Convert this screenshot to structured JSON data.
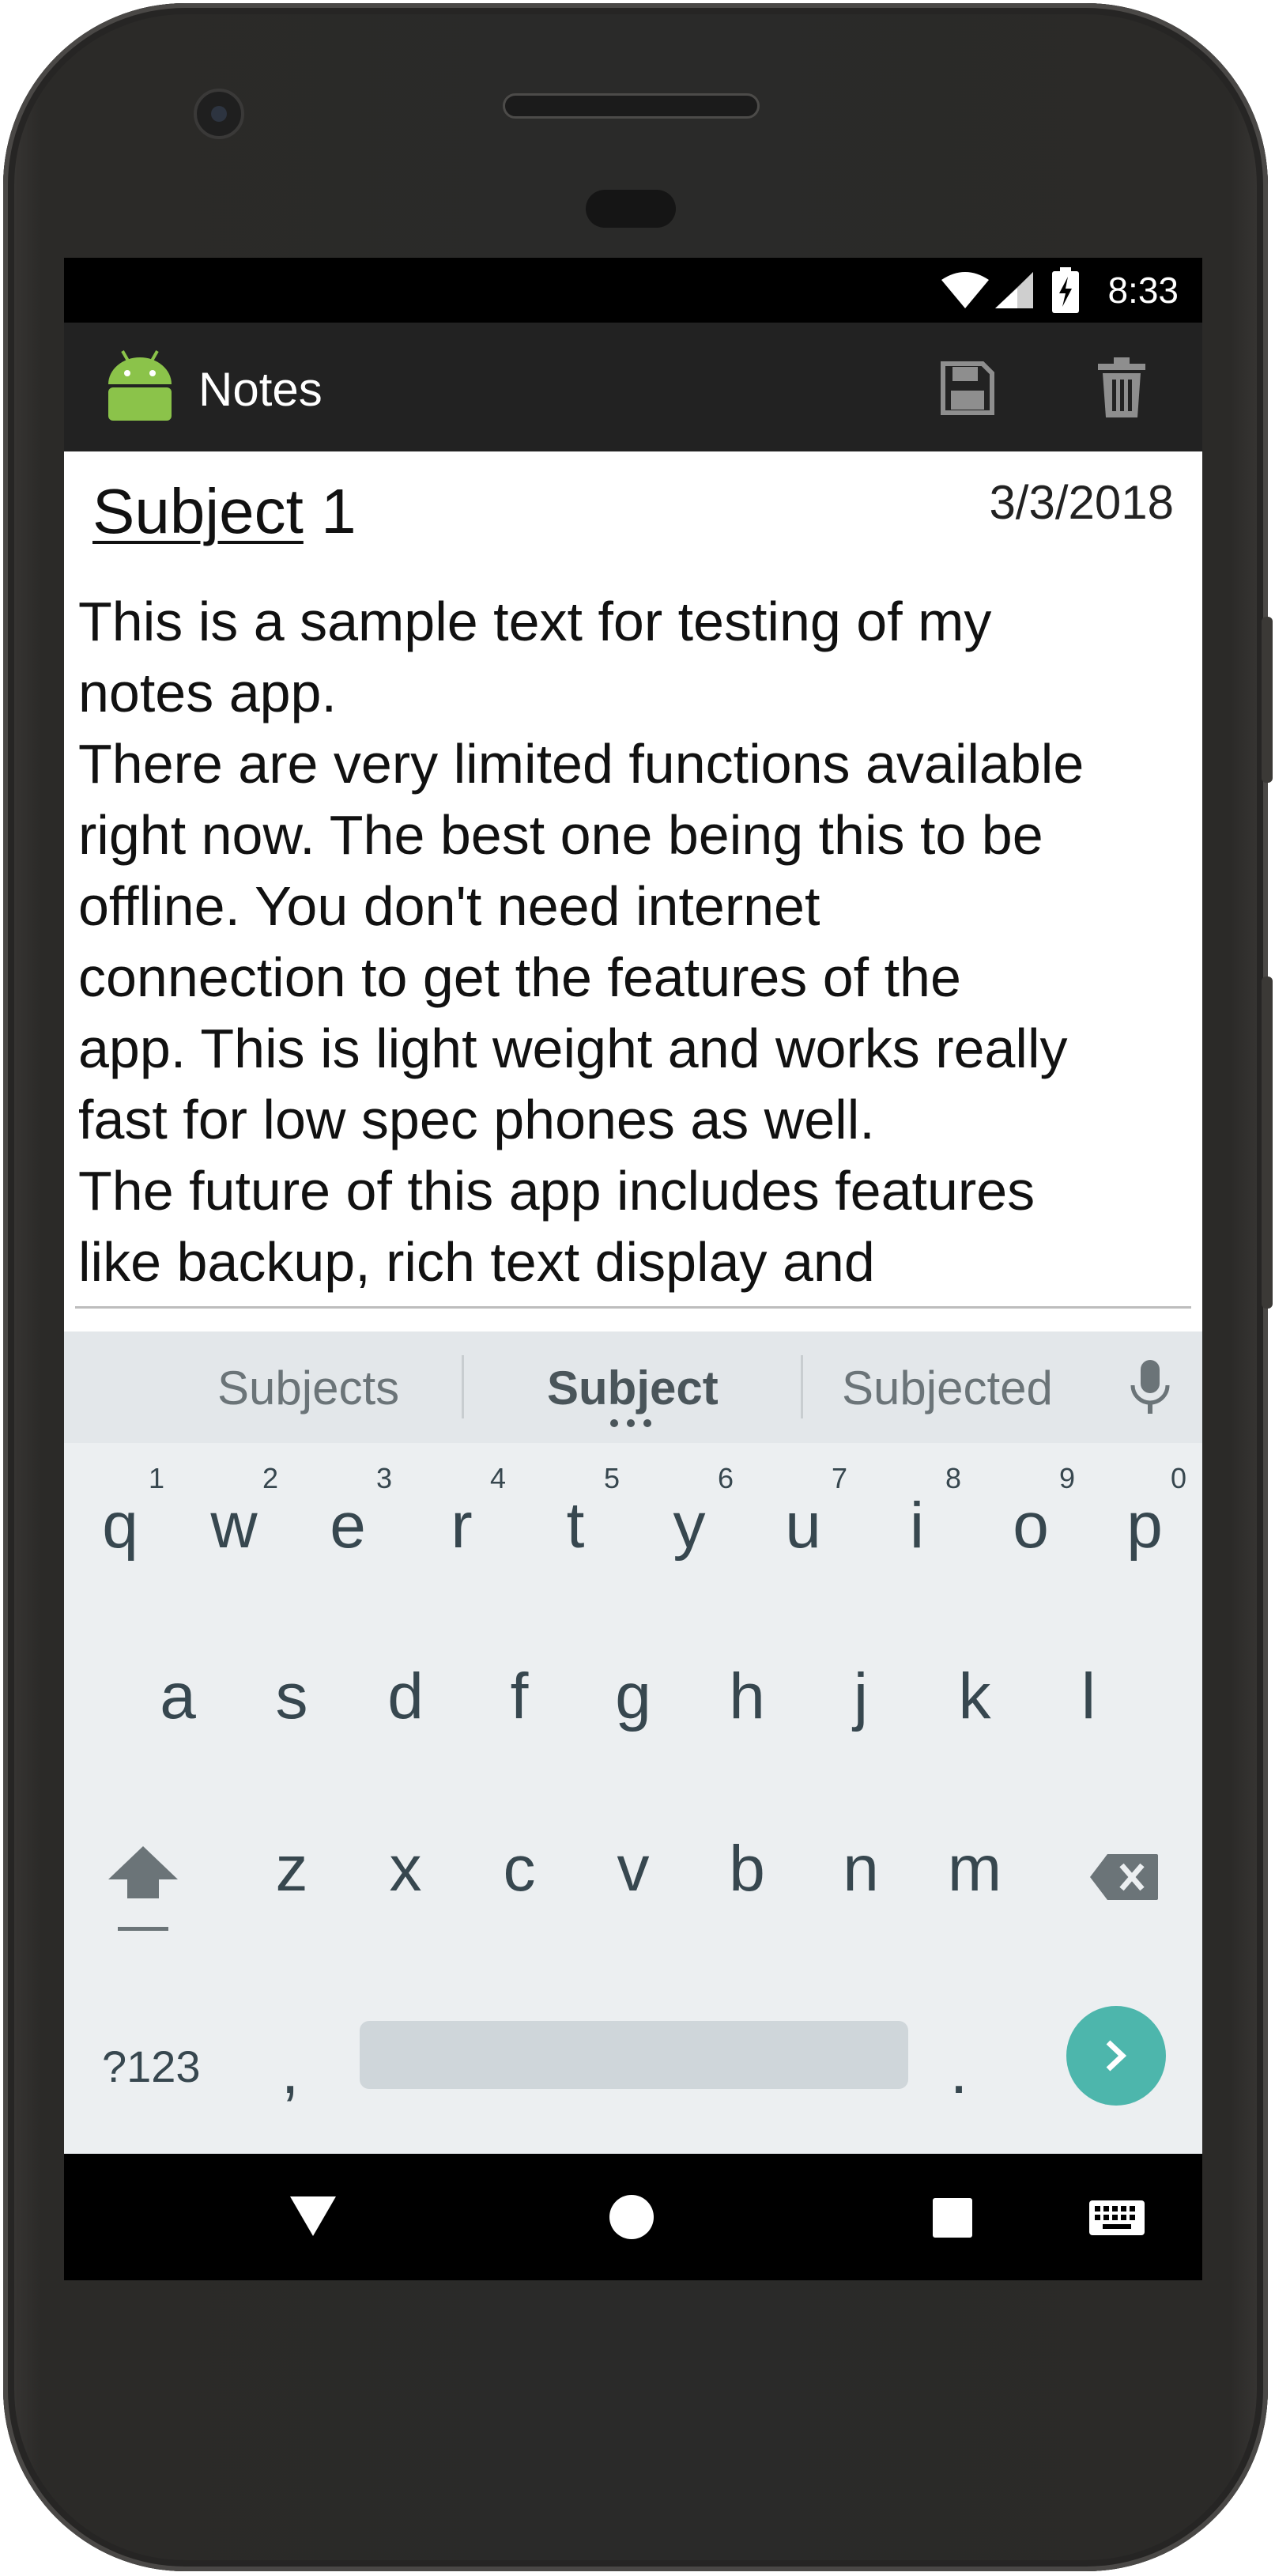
{
  "status_bar": {
    "time": "8:33"
  },
  "app_bar": {
    "title": "Notes"
  },
  "note": {
    "subject_word": "Subject",
    "subject_number": " 1",
    "date": "3/3/2018",
    "body": "This is a sample text for testing of my\nnotes app.\nThere are very limited functions available\nright now. The best one being this to be\noffline. You don't need internet\nconnection to get the features of the\napp. This is light weight and works really\nfast for low spec phones as well.\nThe future of this app includes features\nlike backup, rich text display and"
  },
  "keyboard": {
    "suggestions": [
      "Subjects",
      "Subject",
      "Subjected"
    ],
    "row1": [
      "q",
      "w",
      "e",
      "r",
      "t",
      "y",
      "u",
      "i",
      "o",
      "p"
    ],
    "row1_hints": [
      "1",
      "2",
      "3",
      "4",
      "5",
      "6",
      "7",
      "8",
      "9",
      "0"
    ],
    "row2": [
      "a",
      "s",
      "d",
      "f",
      "g",
      "h",
      "j",
      "k",
      "l"
    ],
    "row3": [
      "z",
      "x",
      "c",
      "v",
      "b",
      "n",
      "m"
    ],
    "symbols_key": "?123",
    "comma_key": ",",
    "period_key": "."
  },
  "icons": [
    "android-logo-icon",
    "save-icon",
    "delete-icon",
    "wifi-icon",
    "signal-icon",
    "battery-icon",
    "mic-icon",
    "shift-icon",
    "backspace-icon",
    "enter-arrow-icon",
    "back-icon",
    "home-icon",
    "recents-icon",
    "keyboard-icon"
  ],
  "colors": {
    "app_bar": "#222222",
    "keyboard_bg": "#eceff1",
    "enter_key": "#4db6ac",
    "android_green": "#8bc34a"
  }
}
